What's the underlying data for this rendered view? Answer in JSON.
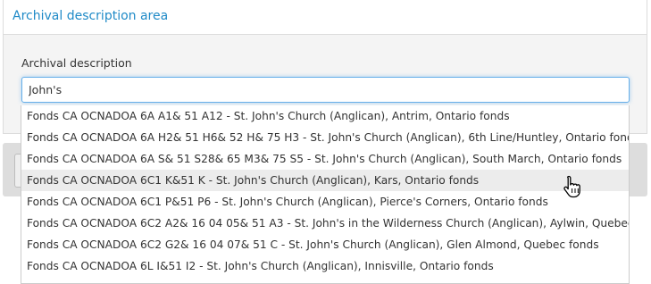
{
  "section": {
    "title": "Archival description area"
  },
  "field": {
    "label": "Archival description",
    "value": "John's"
  },
  "autocomplete": {
    "hover_index": 3,
    "items": [
      "Fonds CA OCNADOA 6A A1& 51 A12 - St. John's Church (Anglican), Antrim, Ontario fonds",
      "Fonds CA OCNADOA 6A H2& 51 H6& 52 H& 75 H3 - St. John's Church (Anglican), 6th Line/Huntley, Ontario fonds",
      "Fonds CA OCNADOA 6A S& 51 S28& 65 M3& 75 S5 - St. John's Church (Anglican), South March, Ontario fonds",
      "Fonds CA OCNADOA 6C1 K&51 K - St. John's Church (Anglican), Kars, Ontario fonds",
      "Fonds CA OCNADOA 6C1 P&51 P6 - St. John's Church (Anglican), Pierce's Corners, Ontario fonds",
      "Fonds CA OCNADOA 6C2 A2& 16 04 05& 51 A3 - St. John's in the Wilderness Church (Anglican), Aylwin, Quebec fonds",
      "Fonds CA OCNADOA 6C2 G2& 16 04 07& 51 C - St. John's Church (Anglican), Glen Almond, Quebec fonds",
      "Fonds CA OCNADOA 6L I&51 I2 - St. John's Church (Anglican), Innisville, Ontario fonds"
    ]
  },
  "pointer": {
    "icon": "hand-pointer-icon"
  }
}
